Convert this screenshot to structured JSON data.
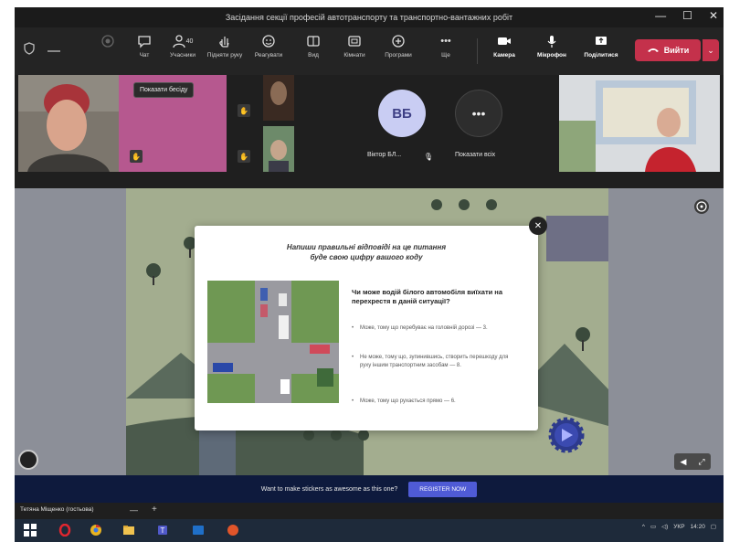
{
  "window": {
    "title": "Засідання секції професій автотранспорту та транспортно-вантажних робіт",
    "min_glyph": "—",
    "max_glyph": "☐",
    "close_glyph": "✕"
  },
  "toolbar": {
    "items": [
      {
        "icon": "chat-icon",
        "label": "Чат"
      },
      {
        "icon": "participants-icon",
        "label": "Учасники",
        "count": "40"
      },
      {
        "icon": "raise-hand-icon",
        "label": "Підняти руку"
      },
      {
        "icon": "reactions-icon",
        "label": "Реагувати"
      },
      {
        "icon": "view-icon",
        "label": "Вид"
      },
      {
        "icon": "rooms-icon",
        "label": "Кімнати"
      },
      {
        "icon": "apps-icon",
        "label": "Програми"
      },
      {
        "icon": "more-icon",
        "label": "Ще"
      },
      {
        "icon": "camera-icon",
        "label": "Камера"
      },
      {
        "icon": "microphone-icon",
        "label": "Мікрофон"
      },
      {
        "icon": "share-icon",
        "label": "Поділитися"
      }
    ],
    "leave_label": "Вийти",
    "leave_caret": "⌄"
  },
  "strip": {
    "tooltip": "Показати бесіду",
    "avatar_initials": "ВБ",
    "avatar_name": "Віктор БЛ...",
    "view_all_label": "Показати всіх",
    "view_all_glyph": "•••"
  },
  "modal": {
    "title_line1": "Напиши правильні відповіді на це питання",
    "title_line2": "буде свою цифру вашого коду",
    "question": "Чи може водій білого автомобіля виїхати на перехрестя в даній ситуації?",
    "answers": [
      "Може, тому що перебуває на головній дорозі — 3.",
      "Не може, тому що, зупинившись, створить перешкоду для руху іншим транспортним засобам — 8.",
      "Може, тому що рухається прямо — 6."
    ],
    "close_glyph": "✕"
  },
  "cue": {
    "text": "Want to make stickers as awesome as this one?",
    "button": "REGISTER NOW"
  },
  "bottom": {
    "presenter_name": "Тетяна Міщенко (гостьова)"
  },
  "taskbar": {
    "lang": "УКР",
    "time": "14:20"
  },
  "colors": {
    "leave": "#c4314b",
    "accent": "#4f5bd5",
    "dark": "#1f1f1f"
  }
}
